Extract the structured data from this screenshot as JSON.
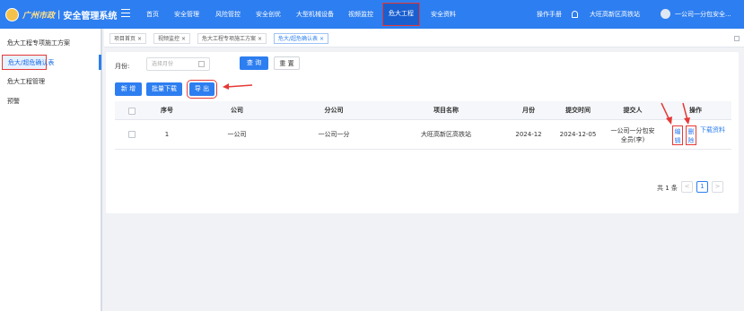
{
  "app": {
    "logo_city": "广州市政",
    "logo_sep": "|",
    "title": "安全管理系统"
  },
  "nav": {
    "items": [
      "首页",
      "安全管理",
      "风险管控",
      "安全创优",
      "大型机械设备",
      "视频监控",
      "危大工程",
      "安全资料"
    ],
    "active": "危大工程"
  },
  "topright": {
    "manual": "操作手册",
    "project": "大旺高新区高铁站",
    "user": "一公司一分包安全..."
  },
  "sidebar": {
    "items": [
      "危大工程专项施工方案",
      "危大/超危确认表",
      "危大工程管理",
      "预警"
    ],
    "active_index": 1
  },
  "tabs": [
    {
      "label": "项目首页",
      "close": "×"
    },
    {
      "label": "视频监控",
      "close": "×"
    },
    {
      "label": "危大工程专项施工方案",
      "close": "×"
    },
    {
      "label": "危大/超危确认表",
      "close": "×"
    }
  ],
  "filter": {
    "month_label": "月份:",
    "month_placeholder": "选择月份",
    "query_button": "查 询",
    "reset_button": "重 置"
  },
  "actions": {
    "add": "新 增",
    "batch_download": "批量下载",
    "export": "导 出"
  },
  "table": {
    "columns": [
      "序号",
      "公司",
      "分公司",
      "项目名称",
      "月份",
      "提交时间",
      "提交人",
      "操作"
    ],
    "rows": [
      {
        "index": "1",
        "company": "一公司",
        "branch": "一公司一分",
        "project": "大旺高新区高铁站",
        "month": "2024-12",
        "submit_time": "2024-12-05",
        "submitter": "一公司一分包安全员(李)",
        "ops": {
          "edit": "编辑",
          "delete": "删除",
          "download": "下载资料"
        }
      }
    ]
  },
  "pager": {
    "total": "共 1 条",
    "prev": "<",
    "current": "1",
    "next": ">"
  },
  "colors": {
    "brand": "#2d7ef0",
    "highlight": "#e53935"
  }
}
